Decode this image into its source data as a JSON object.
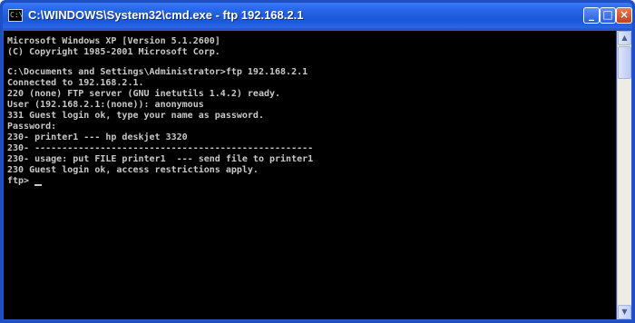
{
  "window": {
    "title": "C:\\WINDOWS\\System32\\cmd.exe - ftp 192.168.2.1",
    "icon": "cmd-icon",
    "controls": {
      "minimize": "_",
      "maximize": "□",
      "close": "×"
    }
  },
  "console": {
    "lines": [
      "Microsoft Windows XP [Version 5.1.2600]",
      "(C) Copyright 1985-2001 Microsoft Corp.",
      "",
      "C:\\Documents and Settings\\Administrator>ftp 192.168.2.1",
      "Connected to 192.168.2.1.",
      "220 (none) FTP server (GNU inetutils 1.4.2) ready.",
      "User (192.168.2.1:(none)): anonymous",
      "331 Guest login ok, type your name as password.",
      "Password:",
      "230- printer1 --- hp deskjet 3320",
      "230- ---------------------------------------------------",
      "230- usage: put FILE printer1  --- send file to printer1",
      "230 Guest login ok, access restrictions apply."
    ],
    "prompt": "ftp> "
  },
  "scrollbar": {
    "up": "▲",
    "down": "▼"
  },
  "colors": {
    "titlebar": "#2565e8",
    "console_bg": "#000000",
    "console_text": "#c8c8c8"
  }
}
